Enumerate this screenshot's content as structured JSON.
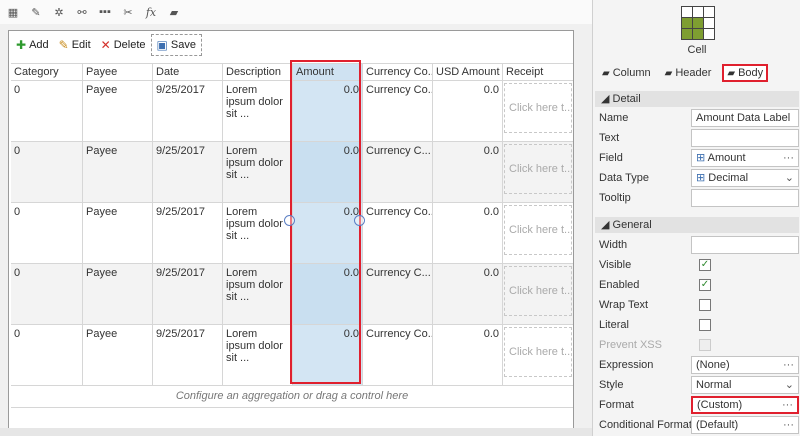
{
  "toolbar_icons": [
    "grid-icon",
    "edit-properties-icon",
    "gear-icon",
    "link-icon",
    "more-icon",
    "cut-icon",
    "function-icon",
    "graduation-cap-icon"
  ],
  "grid": {
    "toolbar": {
      "add_label": "Add",
      "edit_label": "Edit",
      "delete_label": "Delete",
      "save_label": "Save"
    },
    "columns": [
      "Category",
      "Payee",
      "Date",
      "Description",
      "Amount",
      "Currency Co...",
      "USD Amount",
      "Receipt"
    ],
    "rows": [
      {
        "category": "0",
        "payee": "Payee",
        "date": "9/25/2017",
        "description": "Lorem ipsum dolor sit ...",
        "amount": "0.0",
        "currency": "Currency Co...",
        "usd": "0.0",
        "receipt": "Click here t..."
      },
      {
        "category": "0",
        "payee": "Payee",
        "date": "9/25/2017",
        "description": "Lorem ipsum dolor sit ...",
        "amount": "0.0",
        "currency": "Currency C...",
        "usd": "0.0",
        "receipt": "Click here t..."
      },
      {
        "category": "0",
        "payee": "Payee",
        "date": "9/25/2017",
        "description": "Lorem ipsum dolor sit ...",
        "amount": "0.0",
        "currency": "Currency Co...",
        "usd": "0.0",
        "receipt": "Click here t..."
      },
      {
        "category": "0",
        "payee": "Payee",
        "date": "9/25/2017",
        "description": "Lorem ipsum dolor sit ...",
        "amount": "0.0",
        "currency": "Currency C...",
        "usd": "0.0",
        "receipt": "Click here t..."
      },
      {
        "category": "0",
        "payee": "Payee",
        "date": "9/25/2017",
        "description": "Lorem ipsum dolor sit ...",
        "amount": "0.0",
        "currency": "Currency Co...",
        "usd": "0.0",
        "receipt": "Click here t..."
      }
    ],
    "footer": "Configure an aggregation or drag a control here"
  },
  "panel": {
    "title": "Cell",
    "tabs": {
      "column": "Column",
      "header": "Header",
      "body": "Body"
    },
    "detail": {
      "header": "Detail",
      "name_label": "Name",
      "name_value": "Amount Data Label",
      "text_label": "Text",
      "text_value": "",
      "field_label": "Field",
      "field_value": "Amount",
      "datatype_label": "Data Type",
      "datatype_value": "Decimal",
      "tooltip_label": "Tooltip",
      "tooltip_value": ""
    },
    "general": {
      "header": "General",
      "width_label": "Width",
      "width_value": "",
      "visible_label": "Visible",
      "visible_checked": true,
      "enabled_label": "Enabled",
      "enabled_checked": true,
      "wrap_label": "Wrap Text",
      "wrap_checked": false,
      "literal_label": "Literal",
      "literal_checked": false,
      "xss_label": "Prevent XSS",
      "expression_label": "Expression",
      "expression_value": "(None)",
      "style_label": "Style",
      "style_value": "Normal",
      "format_label": "Format",
      "format_value": "(Custom)",
      "condformat_label": "Conditional Format",
      "condformat_value": "(Default)"
    }
  },
  "colors": {
    "highlight": "#e0202e",
    "selected_column": "#d3e5f3",
    "icon_green": "#7e9e31"
  }
}
